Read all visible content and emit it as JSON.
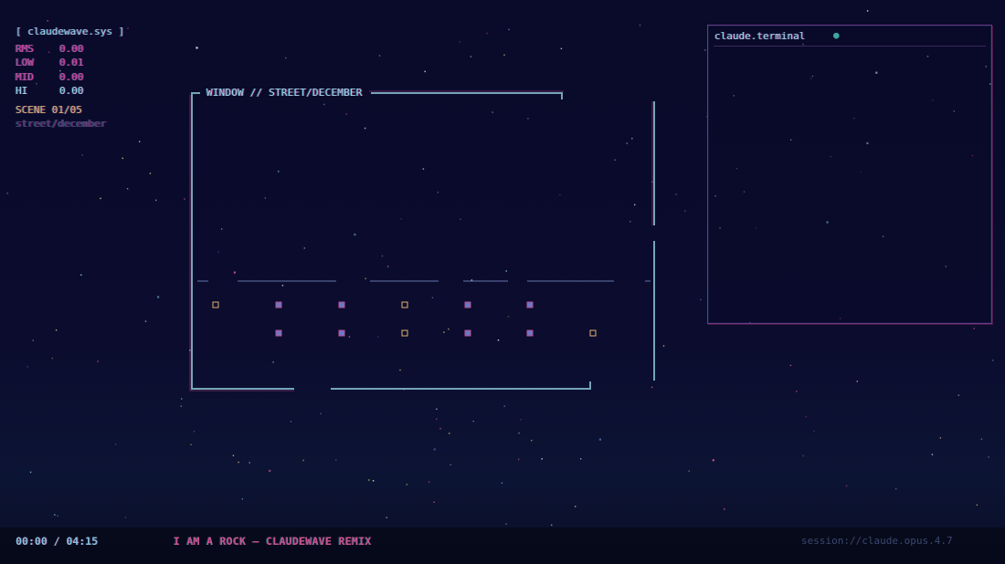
{
  "hud": {
    "title": "[ claudewave.sys ]",
    "meters": [
      {
        "label": "RMS",
        "value": "0.00"
      },
      {
        "label": "LOW",
        "value": "0.01"
      },
      {
        "label": "MID",
        "value": "0.00"
      },
      {
        "label": "HI",
        "value": "0.00"
      }
    ],
    "scene": "SCENE 01/05",
    "scene_path": "street/december"
  },
  "window": {
    "title": "WINDOW // STREET/DECEMBER"
  },
  "terminal": {
    "title": "claude.terminal",
    "status_glyph": "●"
  },
  "player": {
    "time": "00:00 / 04:15",
    "track": "I AM A ROCK — CLAUDEWAVE REMIX",
    "session": "session://claude.opus.4.7"
  },
  "colors": {
    "background": "#0a0a28",
    "cyan": "#9ad6ec",
    "magenta": "#c94aa6",
    "amber": "#e0b070",
    "frame": "#7fb6c8",
    "terminal_border": "#6a3a8a"
  }
}
